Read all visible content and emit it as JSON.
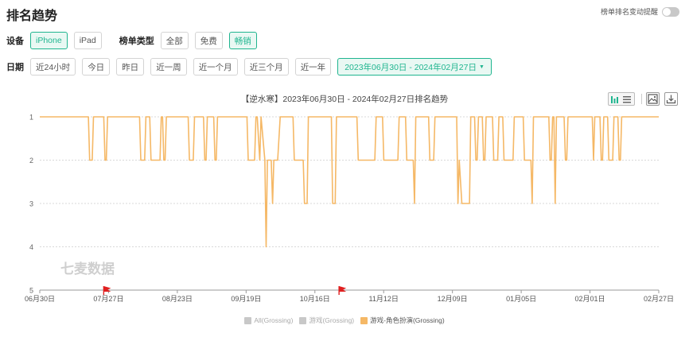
{
  "page": {
    "title": "排名趋势",
    "alert_label": "榜单排名变动提醒"
  },
  "filters": {
    "device_label": "设备",
    "devices": [
      "iPhone",
      "iPad"
    ],
    "device_selected": "iPhone",
    "chart_type_label": "榜单类型",
    "chart_types": [
      "全部",
      "免费",
      "畅销"
    ],
    "chart_type_selected": "畅销",
    "date_label": "日期",
    "dates": [
      "近24小时",
      "今日",
      "昨日",
      "近一周",
      "近一个月",
      "近三个月",
      "近一年"
    ],
    "date_range": "2023年06月30日 - 2024年02月27日"
  },
  "chart": {
    "title": "【逆水寒】2023年06月30日 - 2024年02月27日排名趋势",
    "watermark": "七麦数据",
    "icons": [
      "bar-chart-icon",
      "list-icon",
      "image-download-icon",
      "download-icon"
    ],
    "line_color": "#f5b866",
    "marker_color": "#e02020"
  },
  "chart_data": {
    "type": "line",
    "title": "【逆水寒】2023年06月30日 - 2024年02月27日排名趋势",
    "xlabel": "",
    "ylabel": "",
    "x_ticks": [
      "06月30日",
      "07月27日",
      "08月23日",
      "09月19日",
      "10月16日",
      "11月12日",
      "12月09日",
      "01月05日",
      "02月01日",
      "02月27日"
    ],
    "y_ticks": [
      "1",
      "2",
      "3",
      "4",
      "5"
    ],
    "ylim": [
      1,
      5
    ],
    "y_inverted": true,
    "grid": true,
    "legend_position": "bottom",
    "series": [
      {
        "name": "All(Grossing)",
        "color": "#c8c8c8",
        "visible": false,
        "values": []
      },
      {
        "name": "游戏(Grossing)",
        "color": "#c8c8c8",
        "visible": false,
        "values": []
      },
      {
        "name": "游戏-角色扮演(Grossing)",
        "color": "#f5b866",
        "visible": true,
        "values": [
          [
            0,
            1
          ],
          [
            19,
            1
          ],
          [
            19.5,
            2
          ],
          [
            20.5,
            2
          ],
          [
            21,
            1
          ],
          [
            25,
            1
          ],
          [
            25.5,
            2
          ],
          [
            26,
            2
          ],
          [
            26.5,
            1
          ],
          [
            39,
            1
          ],
          [
            39.5,
            2
          ],
          [
            41,
            2
          ],
          [
            41.5,
            1
          ],
          [
            43,
            1
          ],
          [
            43.5,
            2
          ],
          [
            47,
            2
          ],
          [
            47.5,
            1
          ],
          [
            48,
            1
          ],
          [
            48.5,
            2
          ],
          [
            49,
            2
          ],
          [
            49.5,
            1
          ],
          [
            58,
            1
          ],
          [
            58.5,
            2
          ],
          [
            60,
            2
          ],
          [
            60.5,
            1
          ],
          [
            64,
            1
          ],
          [
            64.5,
            2
          ],
          [
            65,
            2
          ],
          [
            65.5,
            1
          ],
          [
            68,
            1
          ],
          [
            68.5,
            2
          ],
          [
            69,
            2
          ],
          [
            69.5,
            1
          ],
          [
            81,
            1
          ],
          [
            81.5,
            2
          ],
          [
            84,
            2
          ],
          [
            84.5,
            1
          ],
          [
            85,
            1
          ],
          [
            86,
            2
          ],
          [
            86.5,
            1
          ],
          [
            88,
            2
          ],
          [
            88.5,
            4
          ],
          [
            89,
            2
          ],
          [
            90.5,
            2
          ],
          [
            91,
            3
          ],
          [
            91.5,
            2
          ],
          [
            93,
            2
          ],
          [
            94,
            1
          ],
          [
            99,
            1
          ],
          [
            99.5,
            2
          ],
          [
            103,
            2
          ],
          [
            103.5,
            3
          ],
          [
            104.5,
            3
          ],
          [
            105,
            1
          ],
          [
            114,
            1
          ],
          [
            114.5,
            3
          ],
          [
            115.5,
            3
          ],
          [
            116,
            1
          ],
          [
            124,
            1
          ],
          [
            124.5,
            2
          ],
          [
            131,
            2
          ],
          [
            131.5,
            1
          ],
          [
            134,
            1
          ],
          [
            134.5,
            2
          ],
          [
            140,
            2
          ],
          [
            140.5,
            1
          ],
          [
            143,
            1
          ],
          [
            143.5,
            2
          ],
          [
            146,
            2
          ],
          [
            146.5,
            3
          ],
          [
            147,
            1
          ],
          [
            152,
            1
          ],
          [
            152.5,
            2
          ],
          [
            154,
            2
          ],
          [
            154.5,
            1
          ],
          [
            163,
            1
          ],
          [
            163.5,
            3
          ],
          [
            164,
            2
          ],
          [
            165,
            3
          ],
          [
            168,
            3
          ],
          [
            168.5,
            1
          ],
          [
            170,
            1
          ],
          [
            170.5,
            2
          ],
          [
            171,
            2
          ],
          [
            171.5,
            1
          ],
          [
            173,
            1
          ],
          [
            173.5,
            2
          ],
          [
            174,
            2
          ],
          [
            174.5,
            1
          ],
          [
            177,
            1
          ],
          [
            177.5,
            2
          ],
          [
            179,
            2
          ],
          [
            179.5,
            1
          ],
          [
            181,
            1
          ],
          [
            181.5,
            2
          ],
          [
            185,
            2
          ],
          [
            185.5,
            1
          ],
          [
            189,
            1
          ],
          [
            189.5,
            2
          ],
          [
            192,
            2
          ],
          [
            192.5,
            3
          ],
          [
            193,
            1
          ],
          [
            199,
            1
          ],
          [
            199.5,
            2
          ],
          [
            200,
            2
          ],
          [
            200.5,
            1
          ],
          [
            201,
            1
          ],
          [
            201.5,
            3
          ],
          [
            202,
            1
          ],
          [
            205,
            1
          ],
          [
            205.5,
            2
          ],
          [
            206,
            2
          ],
          [
            206.5,
            1
          ],
          [
            216,
            1
          ],
          [
            216.5,
            2
          ],
          [
            217,
            1
          ],
          [
            219,
            1
          ],
          [
            219.5,
            2
          ],
          [
            220,
            2
          ],
          [
            220.5,
            1
          ],
          [
            222,
            1
          ],
          [
            222.5,
            2
          ],
          [
            224,
            2
          ],
          [
            224.5,
            1
          ],
          [
            226,
            1
          ],
          [
            226.5,
            2
          ],
          [
            227,
            2
          ],
          [
            227.5,
            1
          ],
          [
            242,
            1
          ]
        ]
      }
    ],
    "x_range_days": [
      0,
      242
    ],
    "flags_days": [
      25,
      117
    ]
  },
  "legend": [
    "All(Grossing)",
    "游戏(Grossing)",
    "游戏-角色扮演(Grossing)"
  ]
}
